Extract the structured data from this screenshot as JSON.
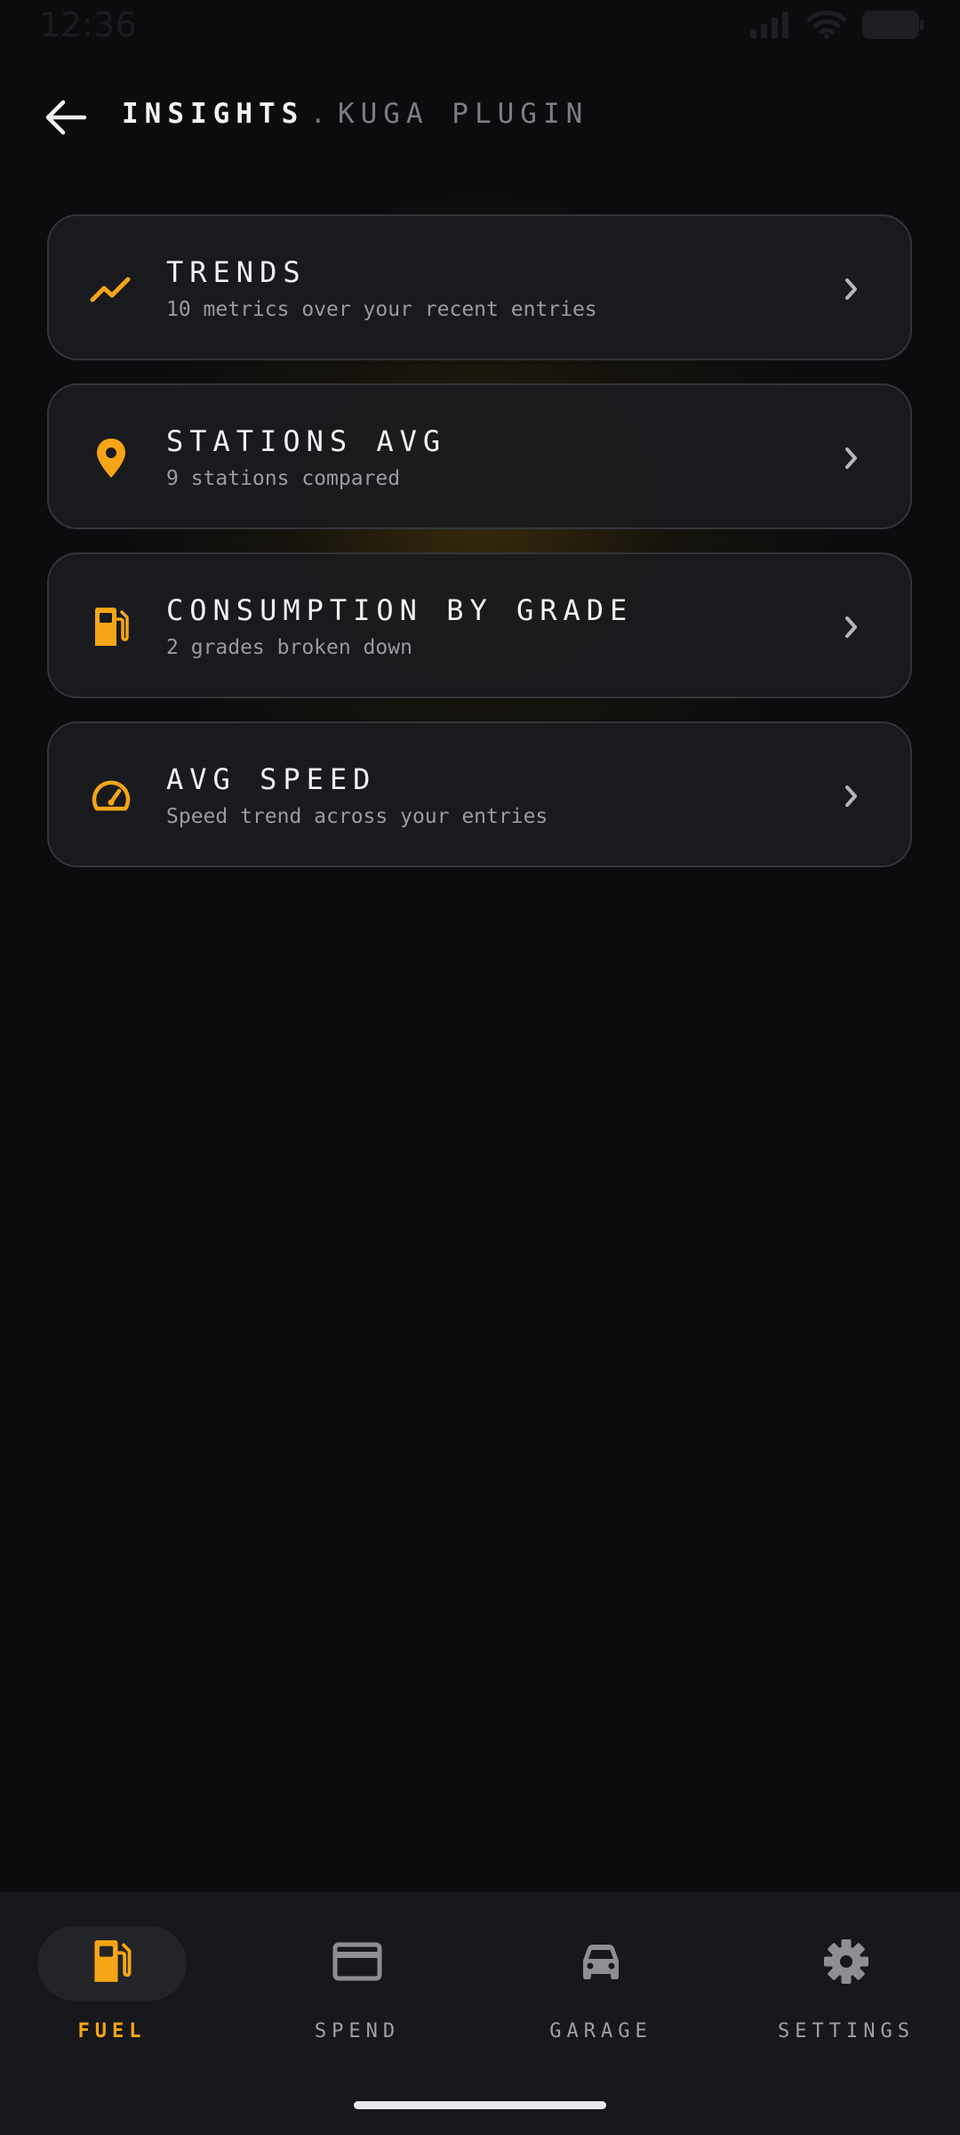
{
  "status_bar": {
    "time": "12:36"
  },
  "header": {
    "title": "INSIGHTS",
    "separator": ".",
    "subtitle": "KUGA PLUGIN"
  },
  "cards": [
    {
      "title": "TRENDS",
      "subtitle": "10 metrics over your recent entries",
      "icon": "trending-up-icon"
    },
    {
      "title": "STATIONS AVG",
      "subtitle": "9 stations compared",
      "icon": "location-pin-icon"
    },
    {
      "title": "CONSUMPTION BY GRADE",
      "subtitle": "2 grades broken down",
      "icon": "fuel-pump-icon"
    },
    {
      "title": "AVG SPEED",
      "subtitle": "Speed trend across your entries",
      "icon": "speedometer-icon"
    }
  ],
  "bottom_nav": {
    "items": [
      {
        "label": "FUEL",
        "icon": "fuel-pump-icon",
        "active": true
      },
      {
        "label": "SPEND",
        "icon": "credit-card-icon",
        "active": false
      },
      {
        "label": "GARAGE",
        "icon": "car-icon",
        "active": false
      },
      {
        "label": "SETTINGS",
        "icon": "gear-icon",
        "active": false
      }
    ]
  },
  "colors": {
    "accent": "#f5a516",
    "background": "#0b0c0e",
    "card": "#1a1b1e",
    "nav": "#17181b"
  }
}
